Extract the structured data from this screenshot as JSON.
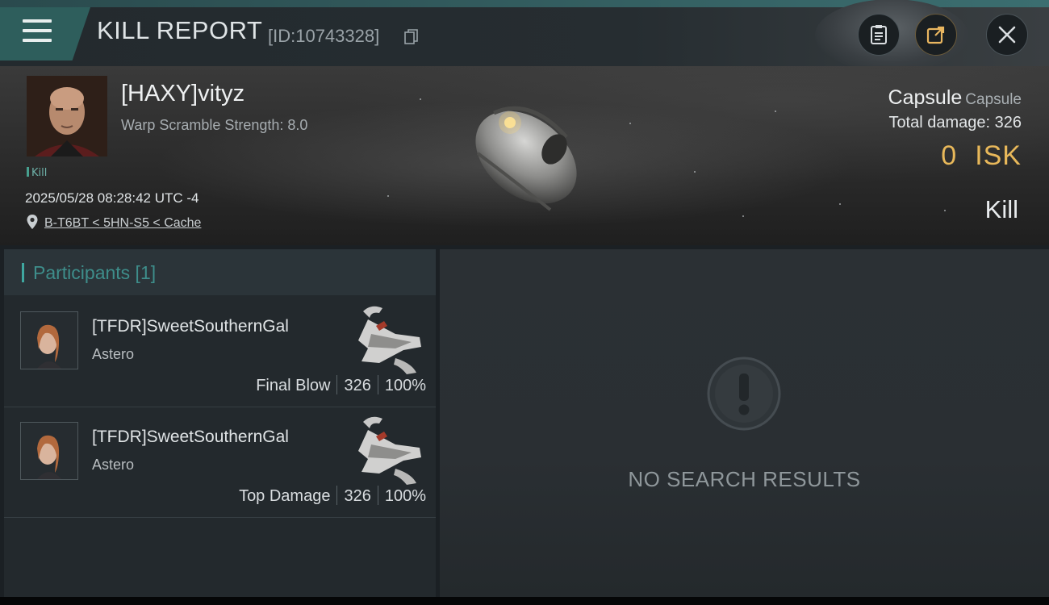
{
  "header": {
    "title": "KILL REPORT",
    "report_id": "[ID:10743328]",
    "icons": [
      "menu-icon",
      "copy-icon",
      "clipboard-icon",
      "share-icon",
      "close-icon"
    ]
  },
  "victim": {
    "name": "[HAXY]vityz",
    "warp_scramble": "Warp Scramble Strength: 8.0",
    "tag": "Kill",
    "datetime": "2025/05/28 08:28:42 UTC -4",
    "location": "B-T6BT < 5HN-S5 < Cache",
    "ship_name": "Capsule",
    "ship_class": "Capsule",
    "total_damage": "Total damage:  326",
    "isk_value": "0",
    "isk_unit": "ISK",
    "report_type": "Kill"
  },
  "participants": {
    "tab_label": "Participants [1]",
    "rows": [
      {
        "name": "[TFDR]SweetSouthernGal",
        "ship": "Astero",
        "role": "Final Blow",
        "damage": "326",
        "percent": "100%"
      },
      {
        "name": "[TFDR]SweetSouthernGal",
        "ship": "Astero",
        "role": "Top Damage",
        "damage": "326",
        "percent": "100%"
      }
    ]
  },
  "results": {
    "empty_text": "NO SEARCH RESULTS"
  },
  "colors": {
    "accent_teal": "#3fa7a0",
    "isk_gold": "#e8b85a",
    "menu_bg": "#2e5e5c"
  }
}
